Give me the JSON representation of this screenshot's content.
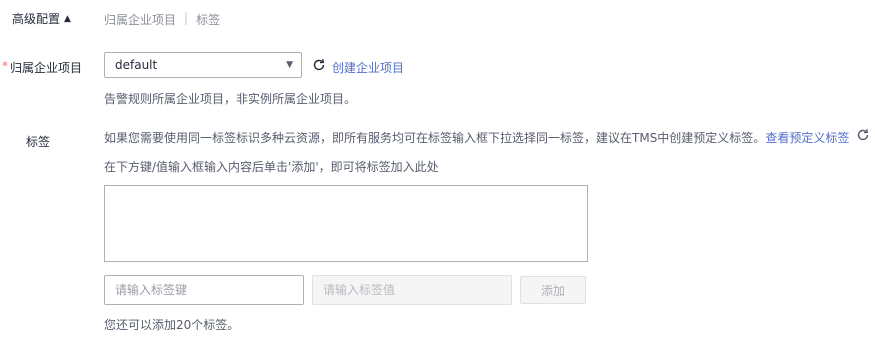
{
  "advanced": {
    "toggle_label": "高级配置",
    "hint_items": [
      "归属企业项目",
      "标签"
    ],
    "hint_separator": "|"
  },
  "enterprise": {
    "required_mark": "*",
    "label": "归属企业项目",
    "selected": "default",
    "create_link": "创建企业项目",
    "tip": "告警规则所属企业项目，非实例所属企业项目。"
  },
  "tags": {
    "label": "标签",
    "desc": "如果您需要使用同一标签标识多种云资源，即所有服务均可在标签输入框下拉选择同一标签，建议在TMS中创建预定义标签。",
    "desc_link": "查看预定义标签",
    "tip": "在下方键/值输入框输入内容后单击'添加'，即可将标签加入此处",
    "key_placeholder": "请输入标签键",
    "value_placeholder": "请输入标签值",
    "add_button": "添加",
    "remaining": "您还可以添加20个标签。"
  },
  "colors": {
    "link": "#526ecc",
    "required": "#f66f6a",
    "text": "#252b3a",
    "muted": "#575d6c"
  }
}
